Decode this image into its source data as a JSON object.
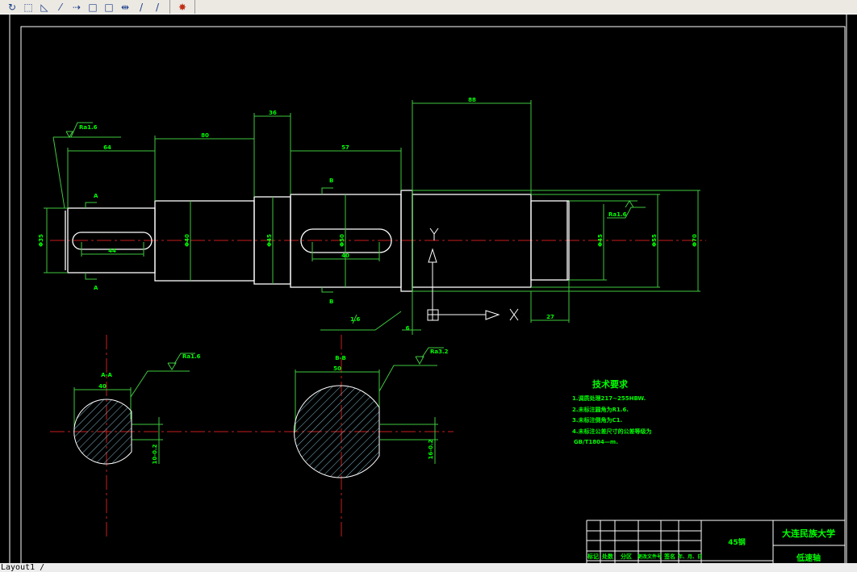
{
  "toolbar": {
    "icons": [
      "orbit-icon",
      "dotted-rect-icon",
      "dimension-icon",
      "break-line-icon",
      "extend-icon",
      "rectangle-icon",
      "square-icon",
      "join-icon",
      "trim-icon",
      "stretch-icon",
      "explode-icon"
    ]
  },
  "colors": {
    "background": "#000000",
    "geometry": "#ffffff",
    "dimension": "#00ff00",
    "centerline": "#c81e1e",
    "hatch": "#9fe8ff"
  },
  "drawing": {
    "dims": {
      "d64": "64",
      "d80": "80",
      "d36": "36",
      "d57": "57",
      "d88": "88",
      "d27": "27",
      "key1": "44",
      "key2": "40",
      "dia_left": "Φ35",
      "dia2": "Φ40",
      "dia3": "Φ45",
      "dia4": "Φ50",
      "dia_bear": "Φ45",
      "dia6": "Φ55",
      "dia7": "Φ70",
      "collar": "6",
      "sec_a_width": "40",
      "sec_b_width": "50",
      "sec_a_depth": "10-0.2",
      "sec_b_depth": "16-0.2"
    },
    "roughness": {
      "r1": "Ra1.6",
      "r2": "Ra1.6",
      "r3": "1.6",
      "ra_a": "Ra1.6",
      "ra_b": "Ra3.2"
    },
    "section_marks": {
      "a": "A",
      "b": "B",
      "a_title": "A-A",
      "b_title": "B-B"
    },
    "ucs": {
      "x": "X",
      "y": "Y"
    }
  },
  "tech_requirements": {
    "title": "技术要求",
    "lines": [
      "1.调质处理217~255HBW.",
      "2.未标注圆角为R1.6.",
      "3.未标注倒角为C1.",
      "4.未标注公差尺寸的公差等级为",
      "GB/T1804—m."
    ]
  },
  "title_block": {
    "headers": [
      "标记",
      "处数",
      "分区",
      "更改文件号",
      "签名",
      "年、月、日"
    ],
    "material": "45钢",
    "school": "大连民族大学",
    "part_name": "低速轴"
  },
  "layout_tab": {
    "label": "Layout1 /"
  }
}
